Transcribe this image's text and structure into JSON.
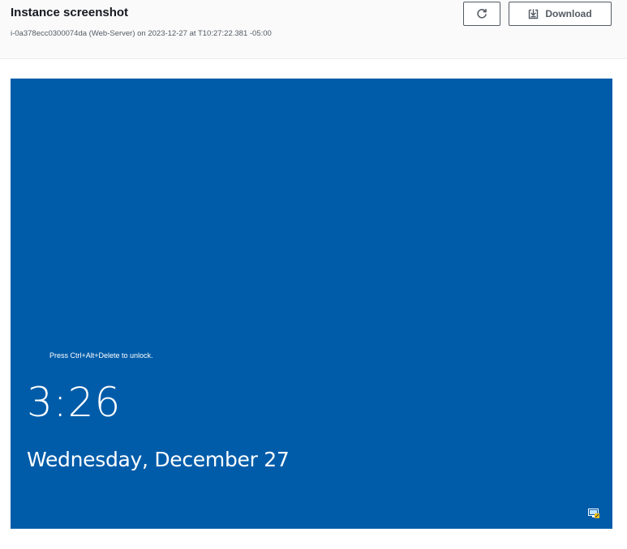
{
  "header": {
    "title": "Instance screenshot",
    "subtitle": "i-0a378ecc0300074da (Web-Server) on 2023-12-27 at T10:27:22.381 -05:00",
    "refresh_icon": "refresh-icon",
    "download_icon": "download-icon",
    "download_label": "Download"
  },
  "lock_screen": {
    "background_color": "#005ca9",
    "unlock_hint": "Press Ctrl+Alt+Delete to unlock.",
    "time": "3:26",
    "date": "Wednesday, December 27",
    "corner_icon": "network-icon"
  }
}
